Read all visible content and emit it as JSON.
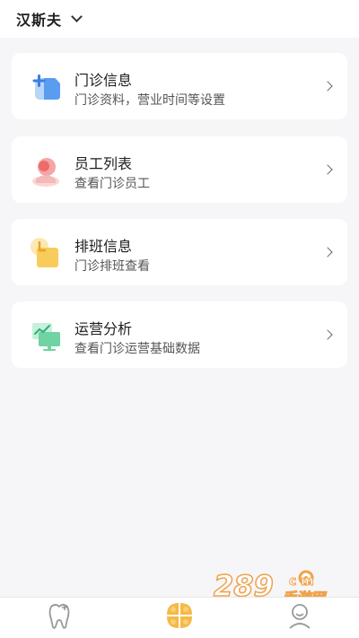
{
  "header": {
    "clinic_name": "汉斯夫"
  },
  "cards": [
    {
      "title": "门诊信息",
      "subtitle": "门诊资料，营业时间等设置",
      "icon": "clinic-info-icon"
    },
    {
      "title": "员工列表",
      "subtitle": "查看门诊员工",
      "icon": "staff-icon"
    },
    {
      "title": "排班信息",
      "subtitle": "门诊排班查看",
      "icon": "schedule-icon"
    },
    {
      "title": "运营分析",
      "subtitle": "查看门诊运营基础数据",
      "icon": "analytics-icon"
    }
  ],
  "tabs": [
    {
      "icon": "tooth-icon",
      "active": false
    },
    {
      "icon": "clover-grid-icon",
      "active": true
    },
    {
      "icon": "profile-icon",
      "active": false
    }
  ],
  "colors": {
    "accent": "#f5b947",
    "background": "#f6f6f8"
  },
  "watermark": {
    "number": "289",
    "suffix": "c m",
    "chinese": "手游网"
  }
}
